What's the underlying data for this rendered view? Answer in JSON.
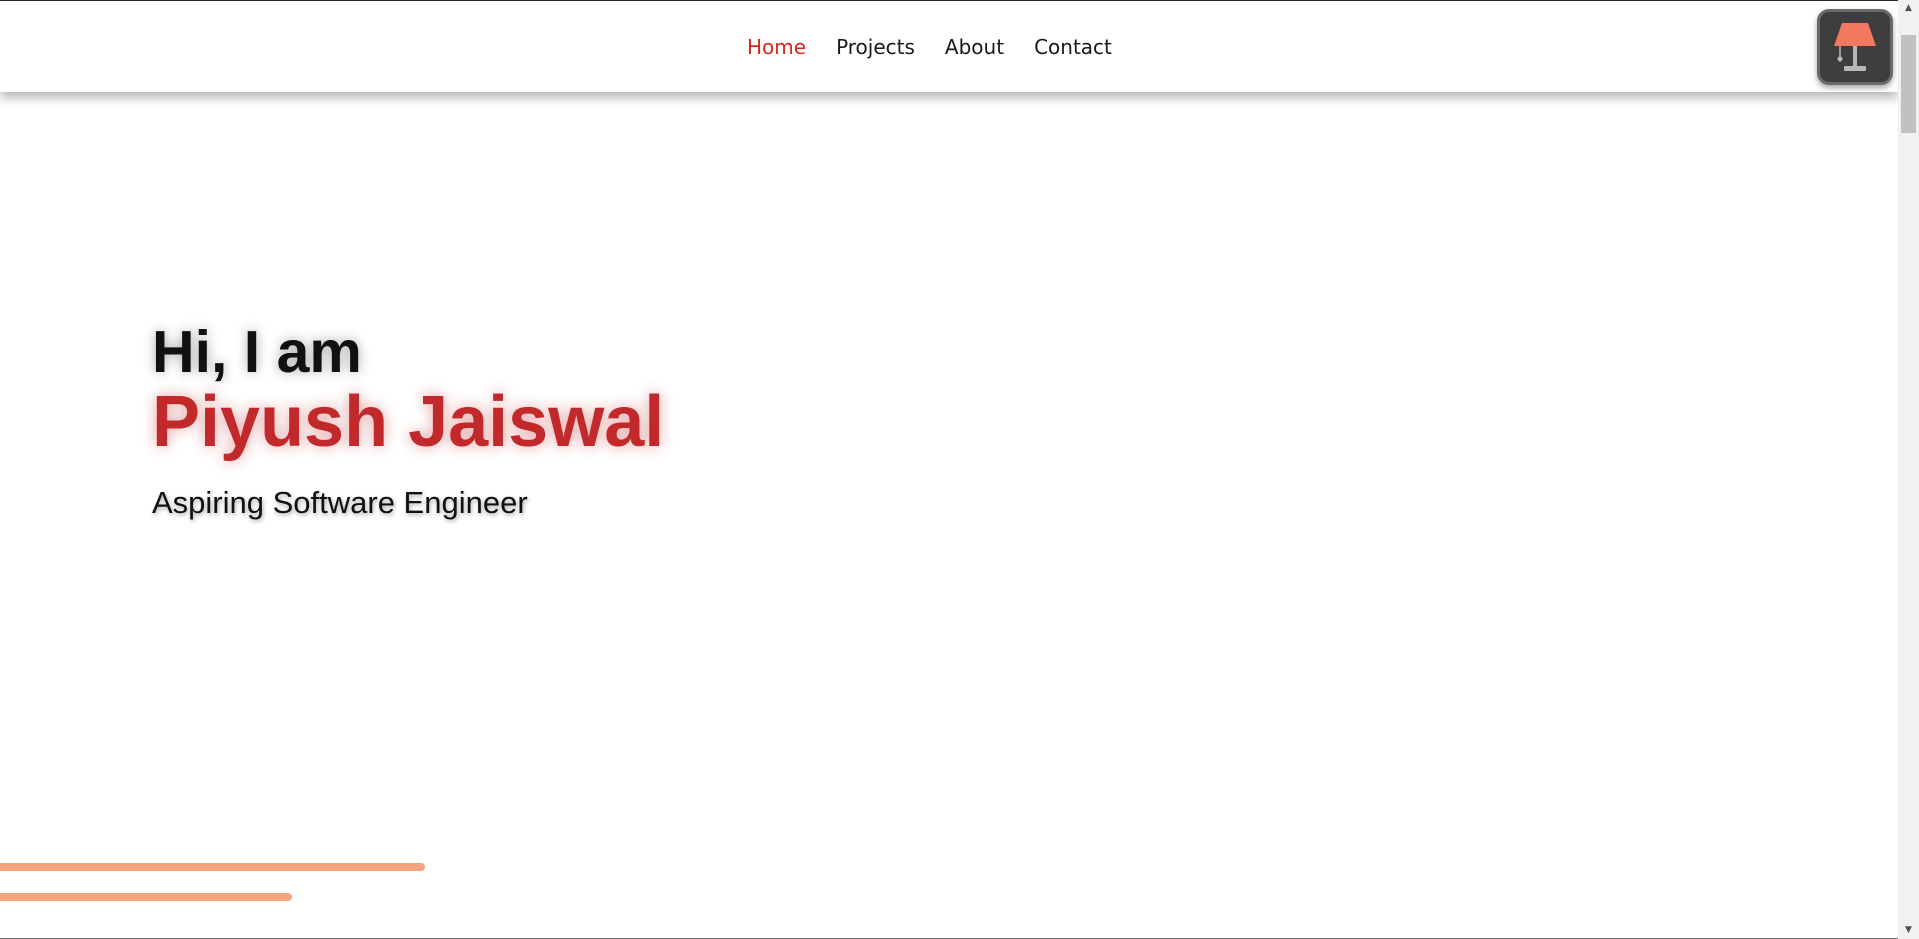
{
  "nav": {
    "items": [
      {
        "label": "Home",
        "active": true
      },
      {
        "label": "Projects",
        "active": false
      },
      {
        "label": "About",
        "active": false
      },
      {
        "label": "Contact",
        "active": false
      }
    ],
    "active_color": "#d7261e"
  },
  "theme_toggle": {
    "icon": "lamp-icon",
    "shade_color": "#f4775f"
  },
  "hero": {
    "greeting": "Hi, I am",
    "name": "Piyush Jaiswal",
    "subtitle": "Aspiring Software Engineer",
    "name_color": "#c1292b"
  },
  "decor": {
    "stripe_color": "#f5a47f"
  },
  "scrollbar": {
    "up_arrow": "▲",
    "down_arrow": "▼"
  }
}
